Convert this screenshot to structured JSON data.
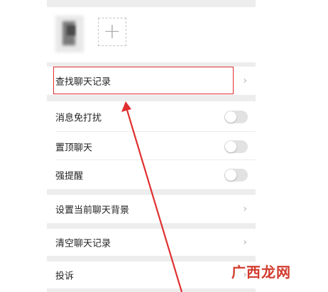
{
  "settings": {
    "items": [
      {
        "label": "查找聊天记录",
        "control": "chevron"
      },
      {
        "label": "消息免打扰",
        "control": "toggle",
        "on": false
      },
      {
        "label": "置顶聊天",
        "control": "toggle",
        "on": false
      },
      {
        "label": "强提醒",
        "control": "toggle",
        "on": false
      },
      {
        "label": "设置当前聊天背景",
        "control": "chevron"
      },
      {
        "label": "清空聊天记录",
        "control": "chevron"
      },
      {
        "label": "投诉",
        "control": "chevron"
      }
    ],
    "chevron_glyph": "›",
    "add_glyph": "+"
  },
  "annotation": {
    "highlight_color": "#e02f2f"
  },
  "watermark": {
    "text": "广西龙网"
  }
}
